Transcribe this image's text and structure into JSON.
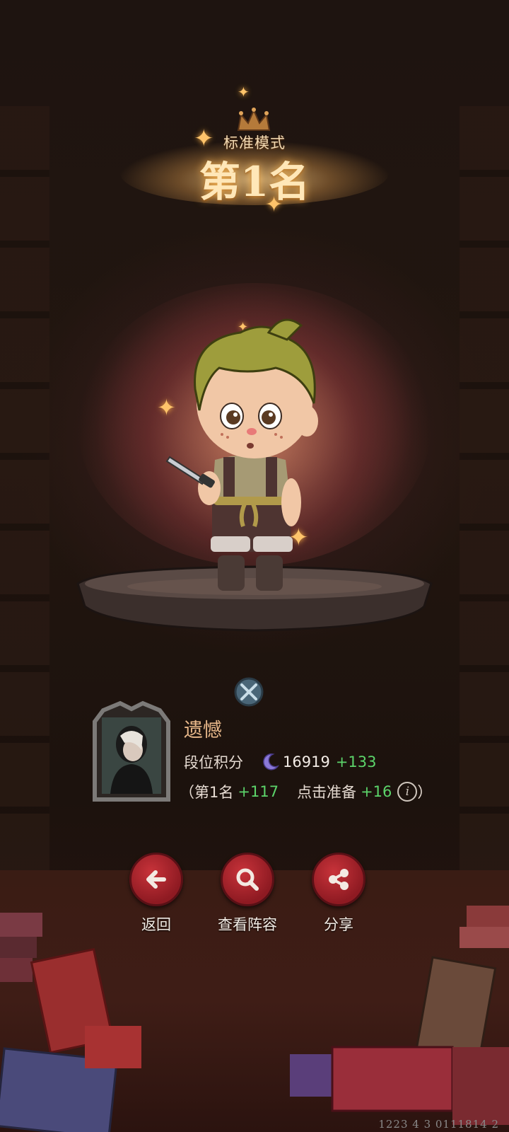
{
  "result": {
    "mode": "标准模式",
    "rank_text": "第1名"
  },
  "player": {
    "name": "遗憾",
    "score_label": "段位积分",
    "score": "16919",
    "score_delta": "+133",
    "bonus_open": "（",
    "rank_bonus_label": "第1名",
    "rank_bonus": "+117",
    "ready_bonus_label": "点击准备",
    "ready_bonus": "+16",
    "bonus_close": "）",
    "info_glyph": "i"
  },
  "actions": [
    {
      "label": "返回",
      "icon": "arrow-left-icon"
    },
    {
      "label": "查看阵容",
      "icon": "magnifier-icon"
    },
    {
      "label": "分享",
      "icon": "share-icon"
    }
  ],
  "footer": {
    "code": "1223 4 3 0111814 2"
  },
  "colors": {
    "action_red": "#b0252d",
    "bonus_green": "#5cd46a",
    "name_color": "#e8b88a",
    "rank_gold": "#ffe7b8"
  }
}
